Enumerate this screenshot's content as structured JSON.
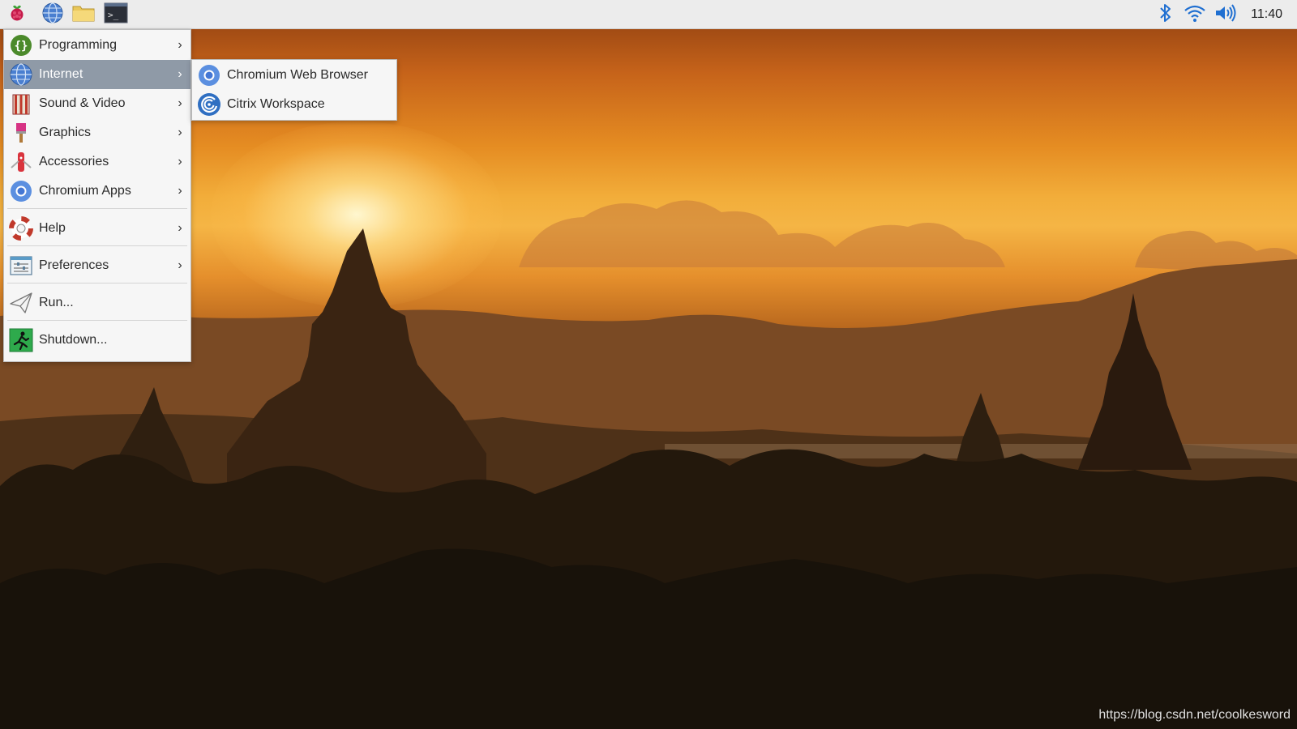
{
  "taskbar": {
    "launchers": [
      {
        "name": "raspberry-menu",
        "icon": "raspberry-icon"
      },
      {
        "name": "web-browser",
        "icon": "globe-icon"
      },
      {
        "name": "file-manager",
        "icon": "folder-icon"
      },
      {
        "name": "terminal",
        "icon": "terminal-icon",
        "glyph": ">_"
      }
    ],
    "tray": {
      "bluetooth_icon": "bluetooth-icon",
      "wifi_icon": "wifi-icon",
      "volume_icon": "volume-icon"
    },
    "clock": "11:40"
  },
  "menu": {
    "items": [
      {
        "label": "Programming",
        "icon": "programming-icon",
        "submenu": true
      },
      {
        "label": "Internet",
        "icon": "internet-icon",
        "submenu": true,
        "active": true
      },
      {
        "label": "Sound & Video",
        "icon": "sound-video-icon",
        "submenu": true
      },
      {
        "label": "Graphics",
        "icon": "graphics-icon",
        "submenu": true
      },
      {
        "label": "Accessories",
        "icon": "accessories-icon",
        "submenu": true
      },
      {
        "label": "Chromium Apps",
        "icon": "chromium-apps-icon",
        "submenu": true
      },
      {
        "label": "Help",
        "icon": "help-icon",
        "submenu": true
      },
      {
        "label": "Preferences",
        "icon": "preferences-icon",
        "submenu": true
      },
      {
        "label": "Run...",
        "icon": "run-icon",
        "submenu": false
      },
      {
        "label": "Shutdown...",
        "icon": "shutdown-icon",
        "submenu": false
      }
    ],
    "arrow": "›"
  },
  "submenu": {
    "items": [
      {
        "label": "Chromium Web Browser",
        "icon": "chromium-icon"
      },
      {
        "label": "Citrix Workspace",
        "icon": "citrix-icon"
      }
    ]
  },
  "colors": {
    "menu_active": "#8f9aa7",
    "menu_bg": "#f6f6f6",
    "taskbar_bg": "#ececec",
    "accent_blue": "#1a73e8"
  },
  "watermark": "https://blog.csdn.net/coolkesword"
}
